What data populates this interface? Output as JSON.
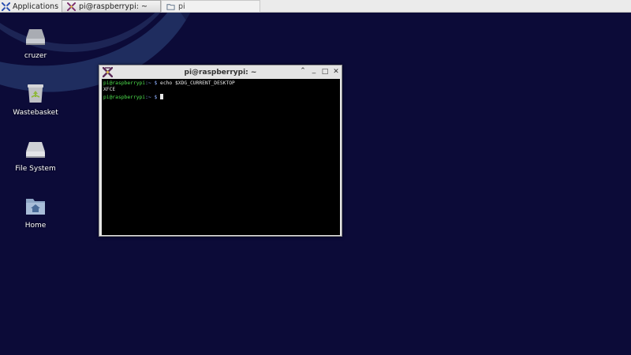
{
  "panel": {
    "apps_label": "Applications",
    "tasks": [
      {
        "label": "pi@raspberrypi: ~",
        "icon": "terminal-icon",
        "state": "active"
      },
      {
        "label": "pi",
        "icon": "folder-icon",
        "state": "inactive"
      }
    ]
  },
  "desktop": {
    "icons": [
      {
        "label": "cruzer",
        "icon": "drive-icon"
      },
      {
        "label": "Wastebasket",
        "icon": "trash-icon"
      },
      {
        "label": "File System",
        "icon": "drive-icon"
      },
      {
        "label": "Home",
        "icon": "home-folder-icon"
      }
    ]
  },
  "terminal": {
    "title": "pi@raspberrypi: ~",
    "controls": {
      "minimize": "⌃",
      "maximize_lower": "_",
      "maximize": "□",
      "close": "✕"
    },
    "lines": [
      {
        "prompt_user": "pi@raspberrypi",
        "prompt_path": ":~",
        "prompt_sym": " $ ",
        "text": "echo $XDG_CURRENT_DESKTOP"
      },
      {
        "output": "XFCE"
      },
      {
        "prompt_user": "pi@raspberrypi",
        "prompt_path": ":~",
        "prompt_sym": " $ ",
        "text": ""
      }
    ]
  },
  "colors": {
    "desktop_bg": "#0c0b38",
    "prompt_green": "#4ee04e",
    "terminal_bg": "#000000"
  }
}
